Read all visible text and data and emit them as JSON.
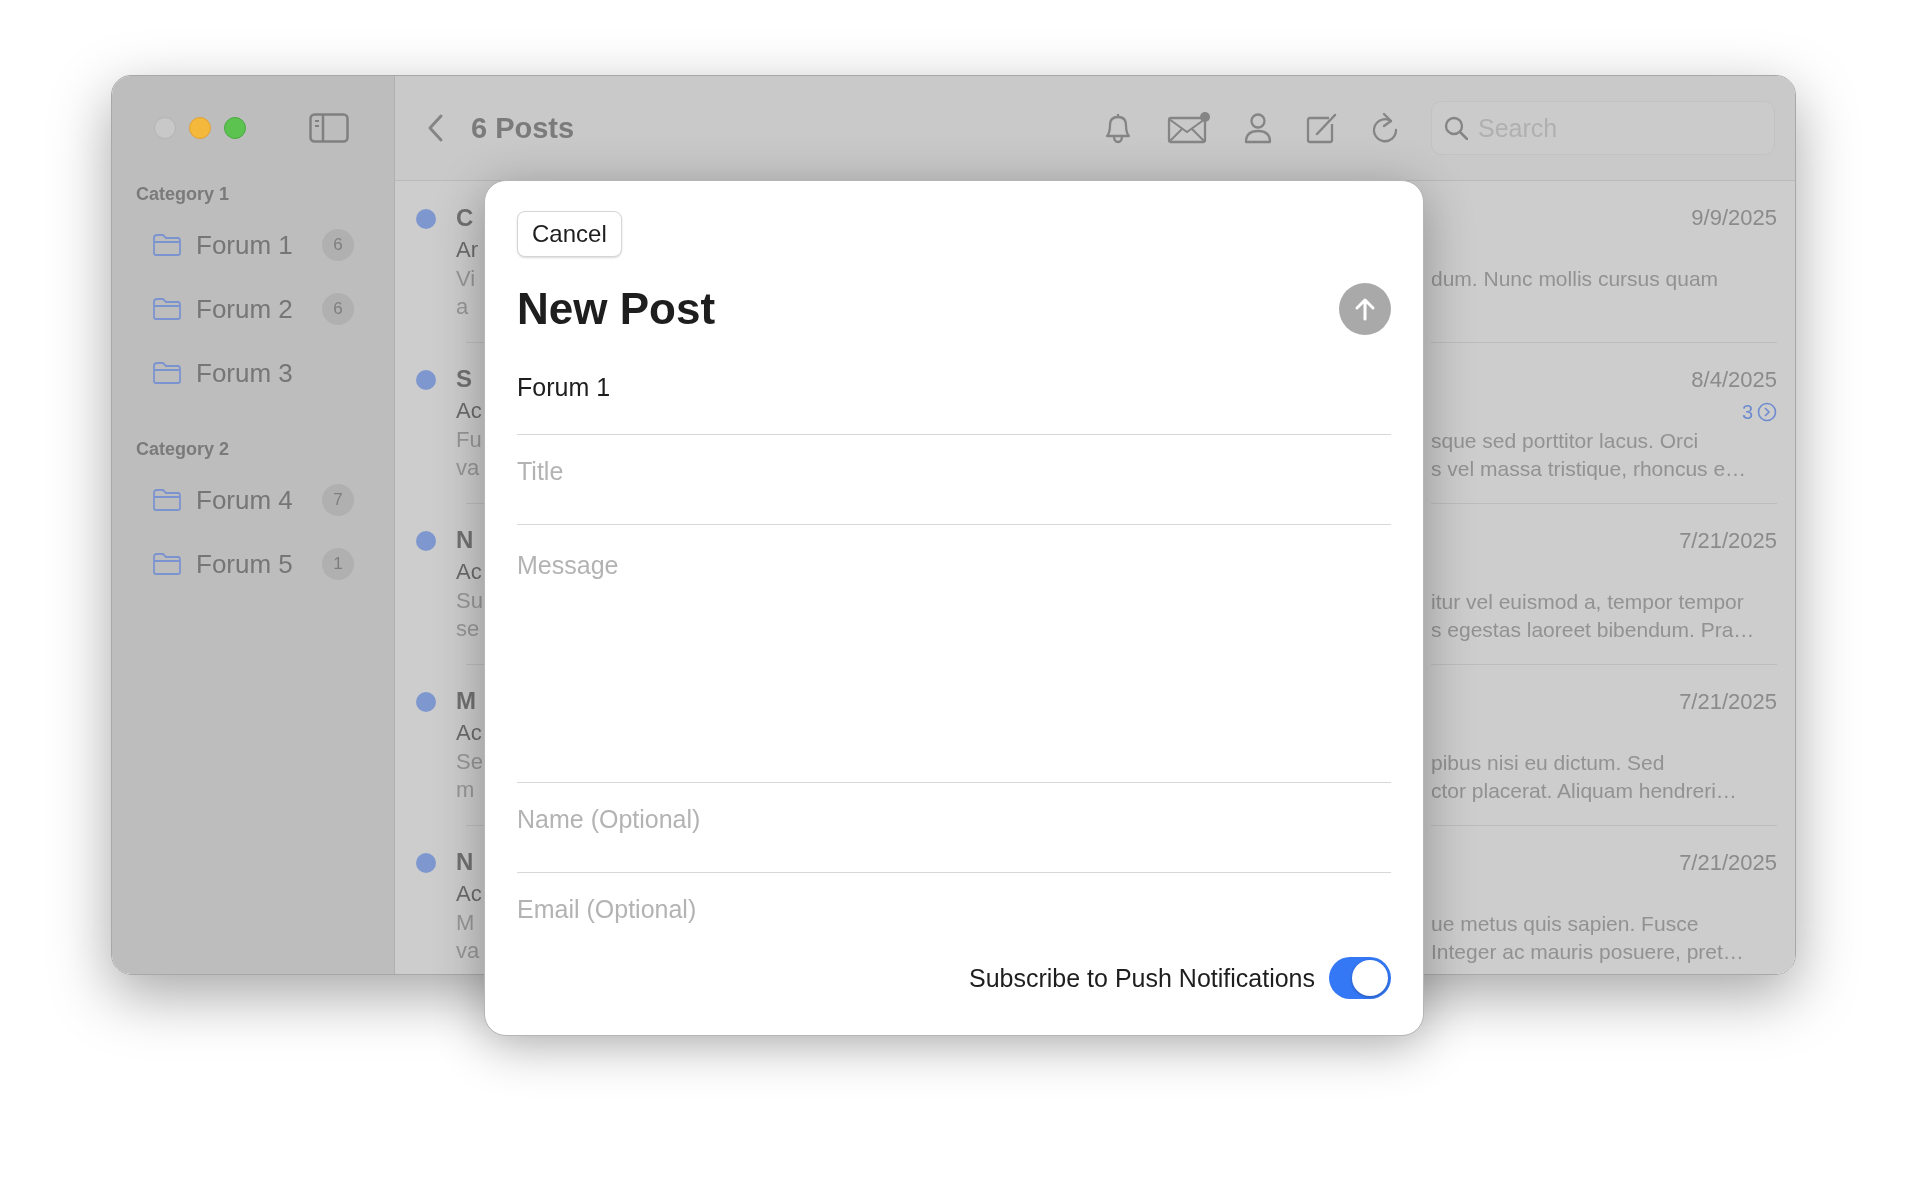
{
  "sidebar": {
    "sections": [
      {
        "title": "Category 1",
        "items": [
          {
            "label": "Forum 1",
            "count": "6"
          },
          {
            "label": "Forum 2",
            "count": "6"
          },
          {
            "label": "Forum 3"
          }
        ]
      },
      {
        "title": "Category 2",
        "items": [
          {
            "label": "Forum 4",
            "count": "7"
          },
          {
            "label": "Forum 5",
            "count": "1"
          }
        ]
      }
    ]
  },
  "toolbar": {
    "title": "6 Posts",
    "search": {
      "placeholder": "Search"
    }
  },
  "posts": [
    {
      "unread": true,
      "title": "C",
      "author": "Ar",
      "preview_head": [
        "Vi",
        "a"
      ],
      "date": "9/9/2025",
      "preview_tail": [
        "dum. Nunc mollis cursus quam"
      ]
    },
    {
      "unread": true,
      "title": "S",
      "author": "Ac",
      "preview_head": [
        "Fu",
        "va"
      ],
      "date": "8/4/2025",
      "replies": "3",
      "preview_tail": [
        "sque sed porttitor lacus. Orci",
        "s vel massa tristique, rhoncus e…"
      ]
    },
    {
      "unread": true,
      "title": "N",
      "author": "Ac",
      "preview_head": [
        "Su",
        "se"
      ],
      "date": "7/21/2025",
      "preview_tail": [
        "itur vel euismod a, tempor tempor",
        "s egestas laoreet bibendum. Pra…"
      ]
    },
    {
      "unread": true,
      "title": "M",
      "author": "Ac",
      "preview_head": [
        "Se",
        "m"
      ],
      "date": "7/21/2025",
      "preview_tail": [
        "pibus nisi eu dictum. Sed",
        "ctor placerat. Aliquam hendreri…"
      ]
    },
    {
      "unread": true,
      "title": "N",
      "author": "Ac",
      "preview_head": [
        "M",
        "va"
      ],
      "date": "7/21/2025",
      "preview_tail": [
        "ue metus quis sapien. Fusce",
        "Integer ac mauris posuere, pret…"
      ]
    }
  ],
  "new_post": {
    "cancel": "Cancel",
    "title": "New Post",
    "send_enabled": false,
    "forum": "Forum 1",
    "fields": [
      {
        "kind": "line",
        "placeholder": "Title"
      },
      {
        "kind": "multiline",
        "placeholder": "Message"
      },
      {
        "kind": "line",
        "placeholder": "Name (Optional)"
      },
      {
        "kind": "line",
        "placeholder": "Email (Optional)"
      }
    ],
    "subscribe": {
      "label": "Subscribe to Push Notifications",
      "on": true
    }
  }
}
